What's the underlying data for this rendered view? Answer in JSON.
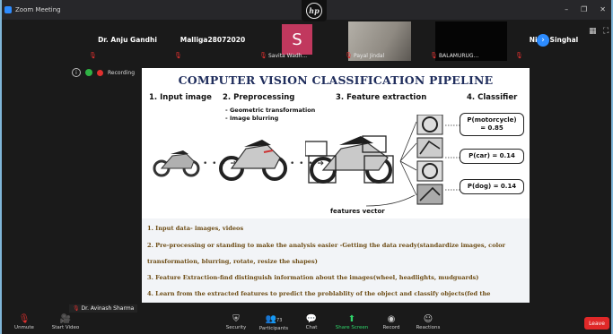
{
  "window": {
    "title": "Zoom Meeting",
    "controls": [
      "–",
      "❐",
      "✕"
    ]
  },
  "participants": [
    {
      "name": "Dr. Anju Gandhi",
      "label": ""
    },
    {
      "name": "Malliga28072020",
      "label": ""
    },
    {
      "name": "S",
      "label": "Savita Wadh..."
    },
    {
      "name": "",
      "label": "Payal Jindal"
    },
    {
      "name": "",
      "label": "BALAMURUG..."
    },
    {
      "name": "Niraj Singhal",
      "label": ""
    }
  ],
  "recording": {
    "label": "Recording"
  },
  "slide": {
    "title": "COMPUTER VISION CLASSIFICATION PIPELINE",
    "steps": [
      "1. Input image",
      "2. Preprocessing",
      "3. Feature extraction",
      "4. Classifier"
    ],
    "preprocessing_items": [
      "- Geometric transformation",
      "- Image blurring"
    ],
    "classifier_outputs": [
      "P(motorcycle)",
      "= 0.85",
      "P(car) = 0.14",
      "P(dog) = 0.14"
    ],
    "features_label": "features vector",
    "notes": [
      "1.  Input data- images, videos",
      "2.  Pre-processing or standing to make the analysis easier -Getting the data ready(standardize images, color",
      "     transformation, blurring, rotate, resize the shapes)",
      "3.  Feature Extraction-find distinguish information about the images(wheel, headlights, mudguards)",
      "4.  Learn from the extracted features to predict the problablity of the object and classify objects(fed the"
    ]
  },
  "active_speaker": "Dr. Avinash Sharma",
  "toolbar": {
    "unmute": "Unmute",
    "start_video": "Start Video",
    "security": "Security",
    "participants": "Participants",
    "participants_count": "73",
    "chat": "Chat",
    "share_screen": "Share Screen",
    "record": "Record",
    "reactions": "Reactions",
    "leave": "Leave"
  }
}
